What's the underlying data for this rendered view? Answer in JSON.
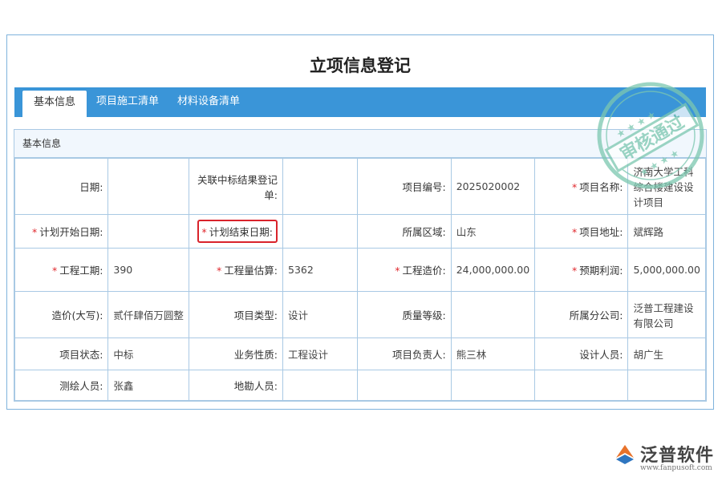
{
  "page_title": "立项信息登记",
  "tabs": [
    {
      "label": "基本信息",
      "active": true
    },
    {
      "label": "项目施工清单",
      "active": false
    },
    {
      "label": "材料设备清单",
      "active": false
    }
  ],
  "section_title": "基本信息",
  "rows": [
    [
      {
        "label": "日期:",
        "required": false,
        "value": ""
      },
      {
        "label": "关联中标结果登记单:",
        "required": false,
        "value": ""
      },
      {
        "label": "项目编号:",
        "required": false,
        "value": "2025020002"
      },
      {
        "label": "项目名称:",
        "required": true,
        "value": "济南大学工科综合楼建设设计项目"
      }
    ],
    [
      {
        "label": "计划开始日期:",
        "required": true,
        "value": ""
      },
      {
        "label": "计划结束日期:",
        "required": true,
        "value": "",
        "highlight": true
      },
      {
        "label": "所属区域:",
        "required": false,
        "value": "山东"
      },
      {
        "label": "项目地址:",
        "required": true,
        "value": "斌辉路"
      }
    ],
    [
      {
        "label": "工程工期:",
        "required": true,
        "value": "390"
      },
      {
        "label": "工程量估算:",
        "required": true,
        "value": "5362"
      },
      {
        "label": "工程造价:",
        "required": true,
        "value": "24,000,000.00"
      },
      {
        "label": "预期利润:",
        "required": true,
        "value": "5,000,000.00"
      }
    ],
    [
      {
        "label": "造价(大写):",
        "required": false,
        "value": "贰仟肆佰万圆整"
      },
      {
        "label": "项目类型:",
        "required": false,
        "value": "设计"
      },
      {
        "label": "质量等级:",
        "required": false,
        "value": ""
      },
      {
        "label": "所属分公司:",
        "required": false,
        "value": "泛普工程建设有限公司"
      }
    ],
    [
      {
        "label": "项目状态:",
        "required": false,
        "value": "中标"
      },
      {
        "label": "业务性质:",
        "required": false,
        "value": "工程设计"
      },
      {
        "label": "项目负责人:",
        "required": false,
        "value": "熊三林"
      },
      {
        "label": "设计人员:",
        "required": false,
        "value": "胡广生"
      }
    ],
    [
      {
        "label": "测绘人员:",
        "required": false,
        "value": "张鑫"
      },
      {
        "label": "地勘人员:",
        "required": false,
        "value": ""
      },
      {
        "label": "",
        "required": false,
        "value": ""
      },
      {
        "label": "",
        "required": false,
        "value": ""
      }
    ]
  ],
  "required_mark": "*",
  "stamp_text": "审核通过",
  "logo": {
    "name": "泛普软件",
    "url": "www.fanpusoft.com"
  },
  "colors": {
    "accent": "#3a95d8",
    "border": "#a9c9e4",
    "required": "#e0282d",
    "stamp": "#7cc7b0"
  }
}
